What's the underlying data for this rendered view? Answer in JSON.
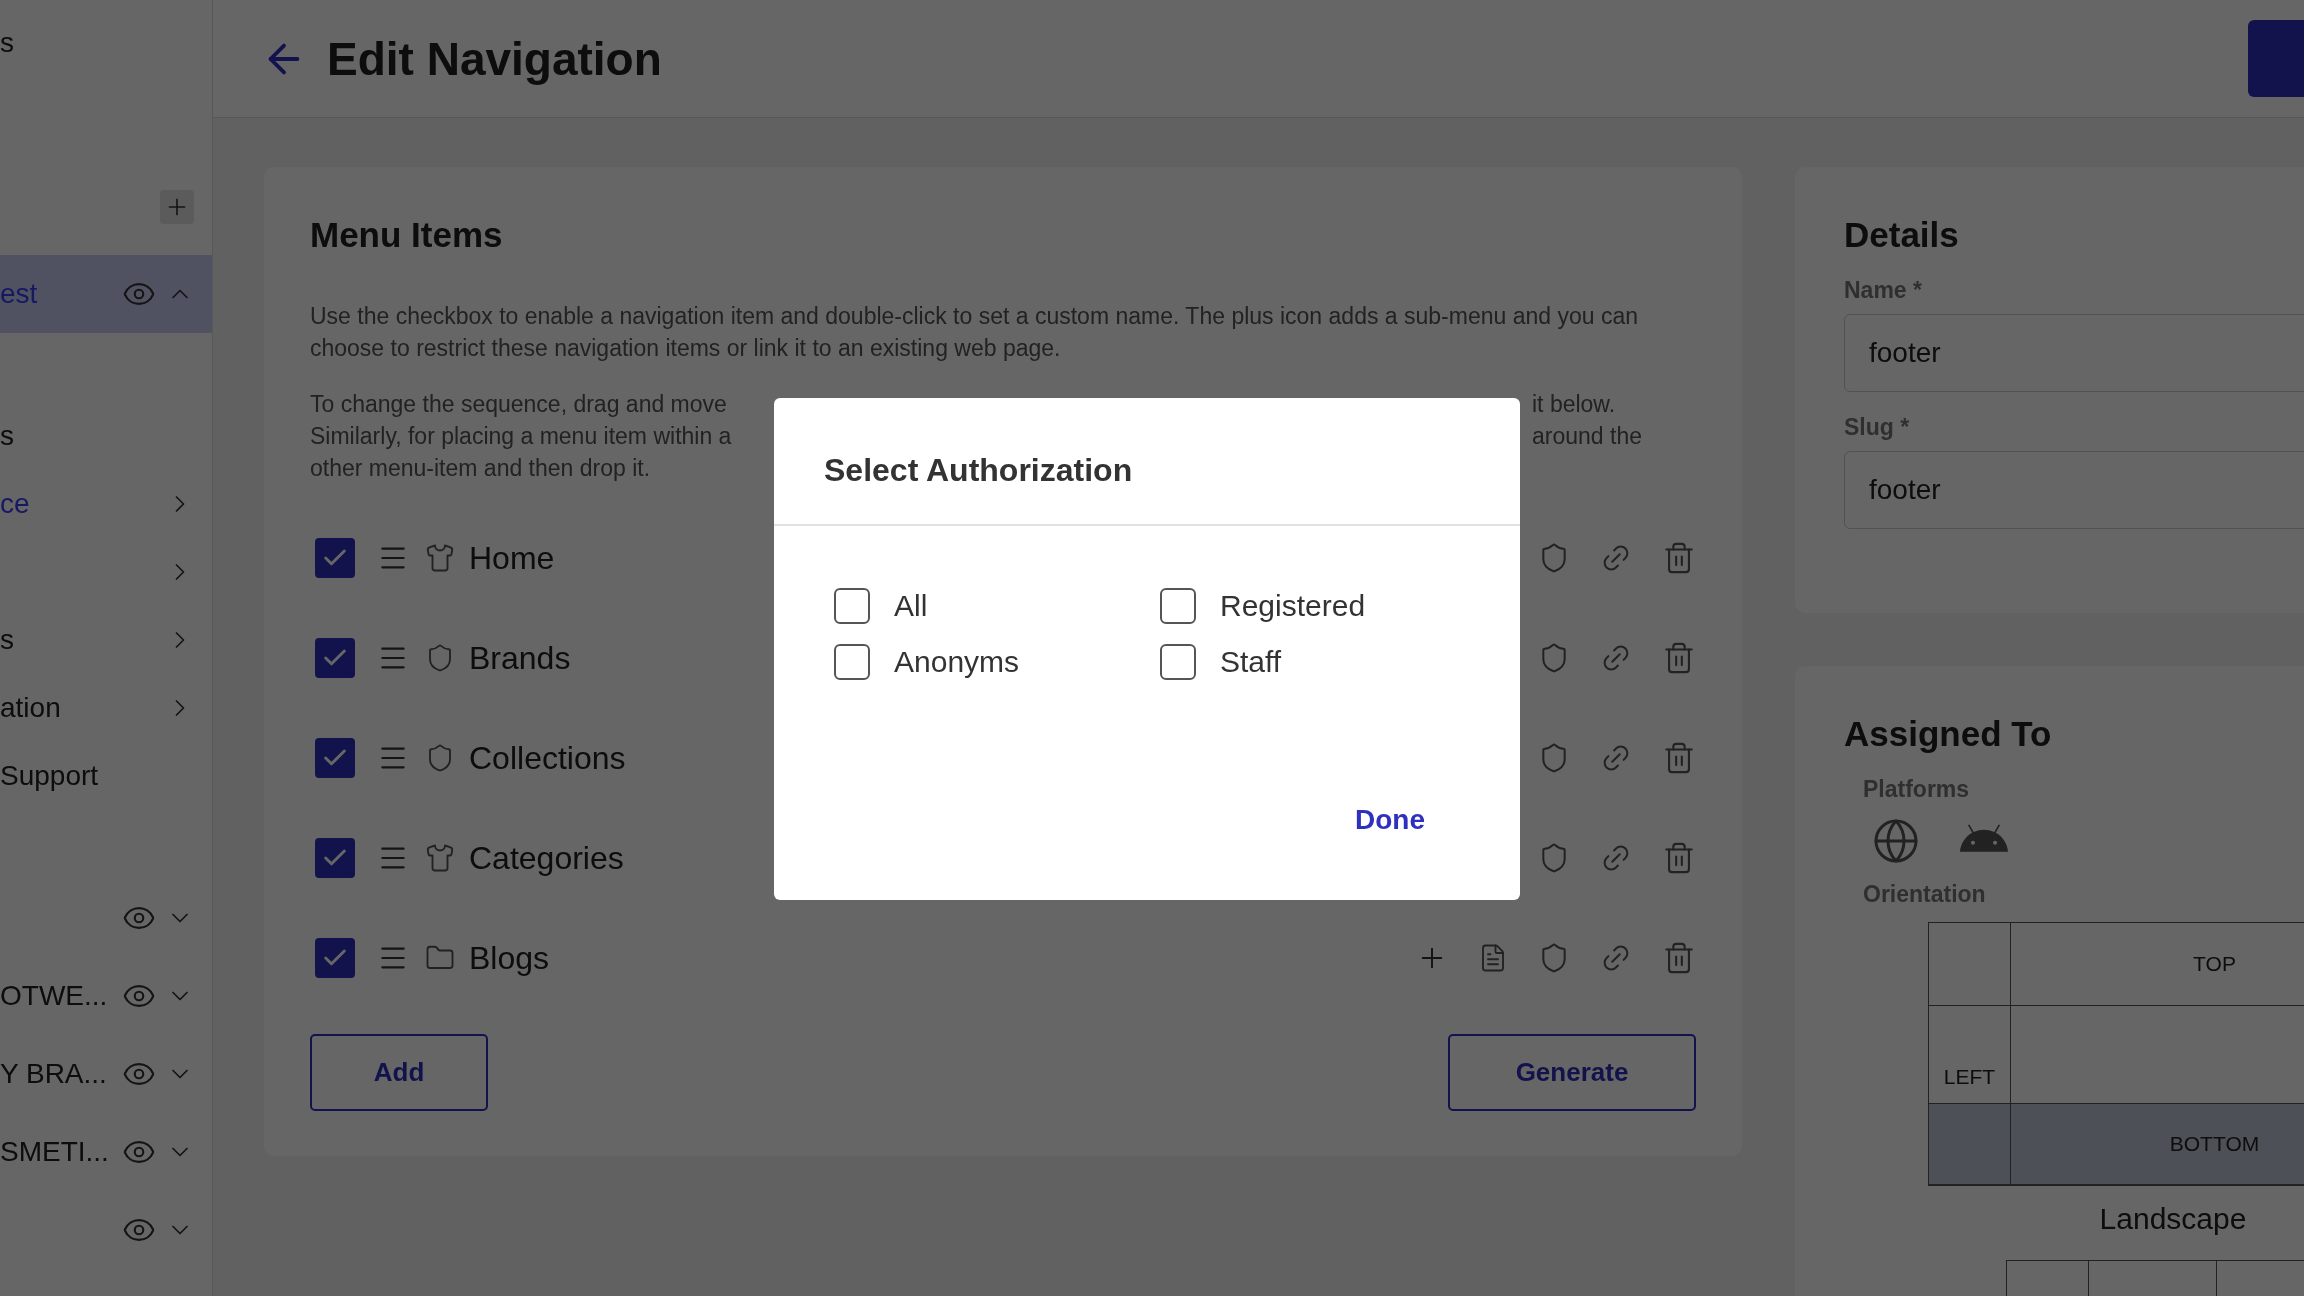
{
  "sidebar": {
    "sections": [
      [
        {
          "kind": "plain",
          "label": "s"
        }
      ],
      [
        {
          "kind": "add"
        },
        {
          "kind": "group",
          "label": "est",
          "selected": true,
          "expanded": true
        }
      ],
      [
        {
          "kind": "plain",
          "label": "s"
        },
        {
          "kind": "submenu",
          "label": "ce",
          "selected": true
        },
        {
          "kind": "submenu"
        },
        {
          "kind": "submenu",
          "label": "s",
          "selected": false
        },
        {
          "kind": "submenu",
          "label": "ation",
          "selected": false
        },
        {
          "kind": "plain",
          "label": "Support"
        }
      ],
      [
        {
          "kind": "group",
          "selected": false,
          "expanded": false
        },
        {
          "kind": "group",
          "label": "OTWE...",
          "selected": false,
          "expanded": false
        },
        {
          "kind": "group",
          "label": "Y BRA...",
          "selected": false,
          "expanded": false
        },
        {
          "kind": "group",
          "label": "SMETI...",
          "selected": false,
          "expanded": false
        },
        {
          "kind": "group",
          "selected": false,
          "expanded": false
        }
      ]
    ]
  },
  "header": {
    "title": "Edit Navigation"
  },
  "menu": {
    "title": "Menu Items",
    "description": "Use the checkbox to enable a navigation item and double-click to set a custom name. The plus icon adds a sub-menu and you can choose to restrict these navigation items or link it to an existing web page.",
    "note_lines": [
      {
        "start": "To change the sequence, drag and move",
        "end": "it below."
      },
      {
        "start": "Similarly, for placing a menu item within a",
        "end": "around the"
      },
      {
        "start": "other menu-item and then drop it."
      }
    ],
    "items": [
      {
        "label": "Home",
        "checked": true
      },
      {
        "label": "Brands",
        "checked": true
      },
      {
        "label": "Collections",
        "checked": true
      },
      {
        "label": "Categories",
        "checked": true
      },
      {
        "label": "Blogs",
        "checked": true
      }
    ],
    "buttons": {
      "add": "Add",
      "generate": "Generate"
    }
  },
  "details": {
    "title": "Details",
    "fields": [
      {
        "label": "Name *",
        "value": "footer"
      },
      {
        "label": "Slug *",
        "value": "footer"
      }
    ]
  },
  "assigned": {
    "title": "Assigned  To",
    "platforms_label": "Platforms",
    "orientation_label": "Orientation",
    "landscape": {
      "top": {
        "label": "TOP",
        "selected": false
      },
      "left": {
        "label": "LEFT",
        "selected": false
      },
      "bottom": {
        "label": "BOTTOM",
        "selected": true
      },
      "caption": "Landscape"
    }
  },
  "dialog": {
    "title": "Select Authorization",
    "options": [
      {
        "label": "All",
        "checked": false
      },
      {
        "label": "Registered",
        "checked": false
      },
      {
        "label": "Anonyms",
        "checked": false
      },
      {
        "label": "Staff",
        "checked": false
      }
    ],
    "done": "Done"
  }
}
